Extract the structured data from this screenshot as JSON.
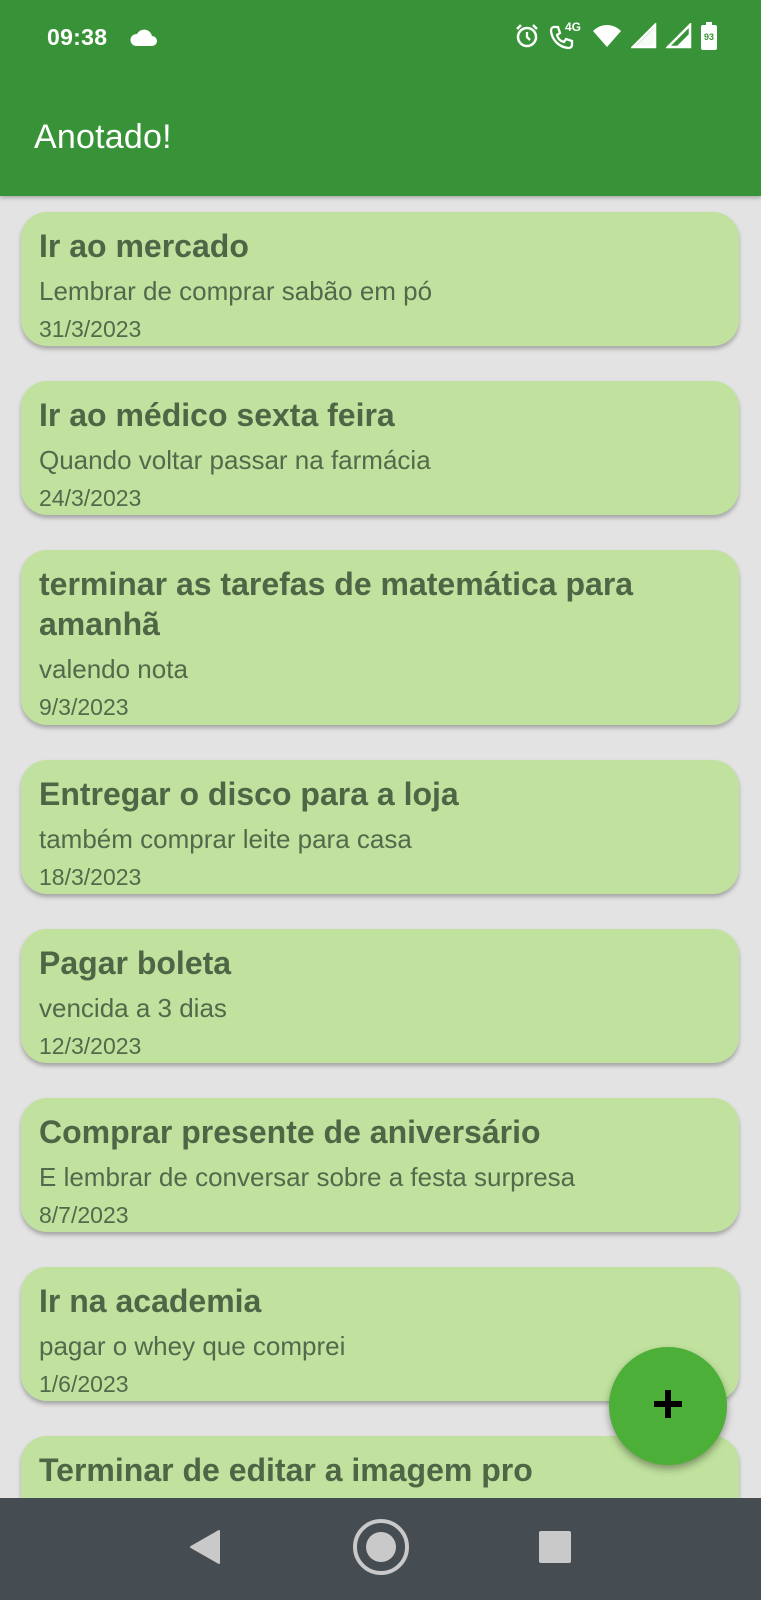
{
  "status_bar": {
    "time": "09:38",
    "network_label": "4G",
    "battery_level": "93",
    "icons": [
      "cloud-icon",
      "alarm-icon",
      "wifi-calling-icon",
      "wifi-icon",
      "signal-icon",
      "signal-icon",
      "battery-icon"
    ]
  },
  "header": {
    "title": "Anotado!"
  },
  "notes": [
    {
      "title": "Ir ao mercado",
      "body": "Lembrar de comprar sabão em pó",
      "date": "31/3/2023"
    },
    {
      "title": "Ir ao médico sexta feira",
      "body": "Quando voltar passar na farmácia",
      "date": "24/3/2023"
    },
    {
      "title": "terminar as tarefas de matemática para amanhã",
      "body": "valendo nota",
      "date": "9/3/2023"
    },
    {
      "title": "Entregar o disco para a loja",
      "body": "também comprar leite para casa",
      "date": "18/3/2023"
    },
    {
      "title": "Pagar boleta",
      "body": "vencida a 3 dias",
      "date": "12/3/2023"
    },
    {
      "title": "Comprar presente de aniversário",
      "body": "E lembrar de conversar sobre a festa surpresa",
      "date": "8/7/2023"
    },
    {
      "title": "Ir na academia",
      "body": "pagar o whey que comprei",
      "date": "1/6/2023"
    },
    {
      "title": "Terminar de editar a imagem pro",
      "body": "",
      "date": ""
    }
  ],
  "fab": {
    "icon": "plus-icon"
  },
  "nav_bar": {
    "icons": [
      "back-icon",
      "home-icon",
      "recents-icon"
    ]
  },
  "colors": {
    "header": "#389338",
    "card": "#c0e29e",
    "card_text": "#4e6646",
    "background": "#e3e3e3",
    "fab": "#4caf37",
    "nav_bar": "#454c52"
  }
}
